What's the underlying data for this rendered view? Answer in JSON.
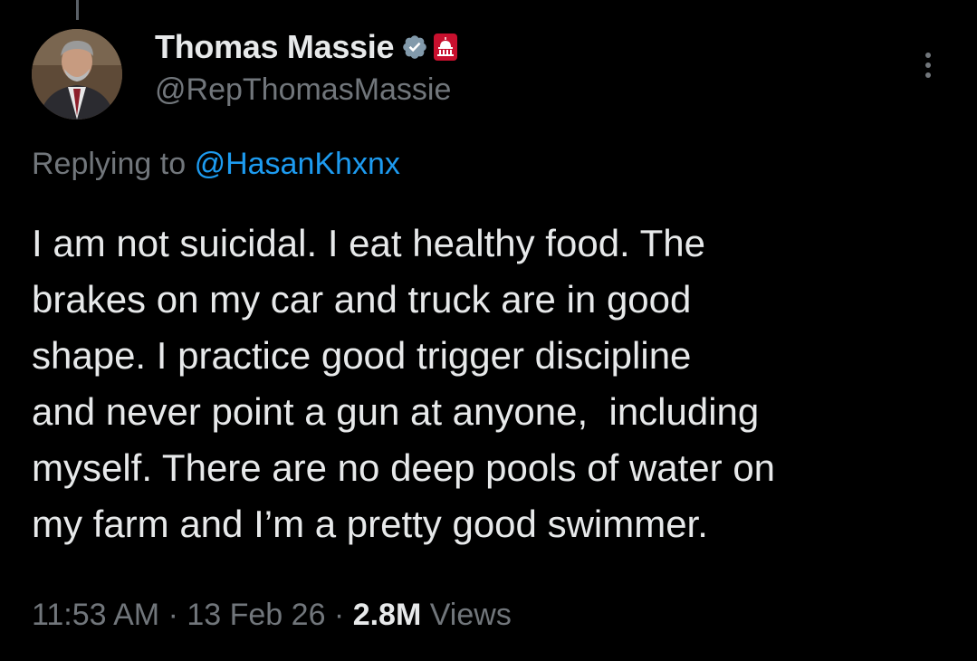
{
  "author": {
    "display_name": "Thomas Massie",
    "handle": "@RepThomasMassie",
    "verified_badge": "verified-check-icon",
    "affiliation_badge": "us-capitol-icon"
  },
  "reply": {
    "prefix": "Replying to",
    "target": "@HasanKhxnx"
  },
  "tweet": {
    "lines": [
      "I am not suicidal. I eat healthy food. The",
      "brakes on my car and truck are in good",
      "shape. I practice good trigger discipline",
      "and never point a gun at anyone,  including",
      "myself. There are no deep pools of water on",
      "my farm and I’m a pretty good swimmer."
    ]
  },
  "meta": {
    "time": "11:53 AM",
    "separator": " · ",
    "date": "13 Feb 26",
    "views_count": "2.8M",
    "views_label": " Views"
  },
  "colors": {
    "background": "#000000",
    "primary_text": "#e7e9ea",
    "secondary_text": "#71767b",
    "link": "#1d9bf0",
    "verified": "#829aab",
    "gov_badge": "#c8102e"
  },
  "icons": {
    "more": "more-vertical-icon"
  }
}
